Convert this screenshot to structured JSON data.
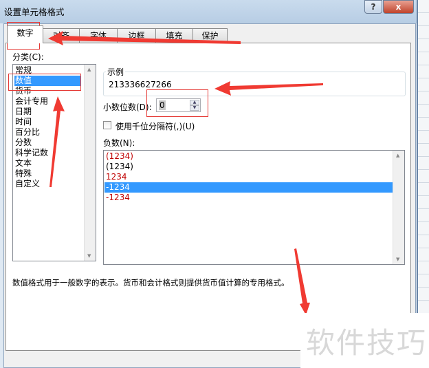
{
  "window": {
    "title": "设置单元格格式",
    "help": "?",
    "close": "x"
  },
  "tabs": [
    {
      "label": "数字"
    },
    {
      "label": "对齐"
    },
    {
      "label": "字体"
    },
    {
      "label": "边框"
    },
    {
      "label": "填充"
    },
    {
      "label": "保护"
    }
  ],
  "category": {
    "label": "分类(C):",
    "items": [
      "常规",
      "数值",
      "货币",
      "会计专用",
      "日期",
      "时间",
      "百分比",
      "分数",
      "科学记数",
      "文本",
      "特殊",
      "自定义"
    ],
    "selected": "数值"
  },
  "sample": {
    "label": "示例",
    "value": "213336627266"
  },
  "decimal": {
    "label": "小数位数(D):",
    "value": "0"
  },
  "thousands": {
    "label": "使用千位分隔符(,)(U)",
    "checked": false
  },
  "negative": {
    "label": "负数(N):",
    "items": [
      {
        "text": "(1234)",
        "color": "#c00000"
      },
      {
        "text": "(1234)",
        "color": "#000000"
      },
      {
        "text": "1234",
        "color": "#c00000"
      },
      {
        "text": "-1234",
        "color": "#ffffff",
        "selected": true
      },
      {
        "text": "-1234",
        "color": "#c00000"
      }
    ]
  },
  "description": "数值格式用于一般数字的表示。货币和会计格式则提供货币值计算的专用格式。",
  "watermark": "软件技巧",
  "colors": {
    "accent": "#3399ff",
    "annotation": "#e53935"
  }
}
